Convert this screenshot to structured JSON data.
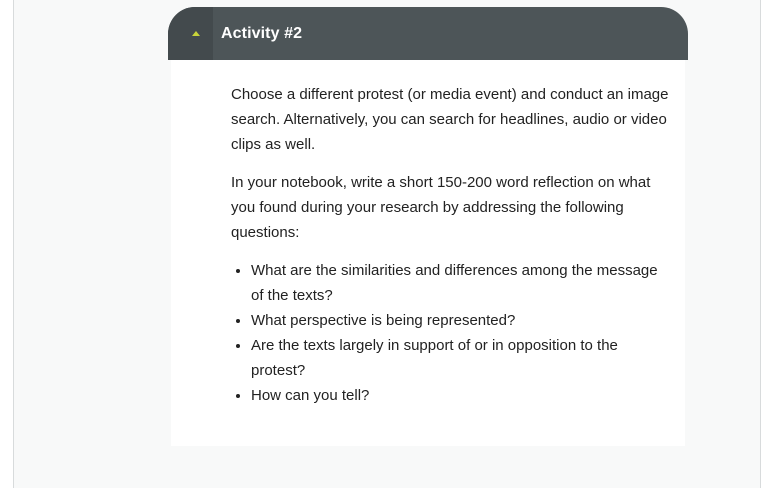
{
  "activity": {
    "title": "Activity #2",
    "paragraphs": [
      "Choose a different protest (or media event) and conduct an image search. Alternatively, you can search for headlines, audio or video clips as well.",
      "In your notebook, write a short 150-200 word reflection on what you found during your research by addressing the following questions:"
    ],
    "questions": [
      "What are the similarities and differences among the message of the texts?",
      "What perspective is being represented?",
      "Are the texts largely in support of or in opposition to the protest?",
      "How can you tell?"
    ]
  },
  "colors": {
    "header_bg": "#4d5558",
    "toggle_bg": "#434a4d",
    "caret": "#c8d43a",
    "page_bg": "#f8f9f9"
  },
  "icons": {
    "toggle": "caret-up-icon"
  }
}
